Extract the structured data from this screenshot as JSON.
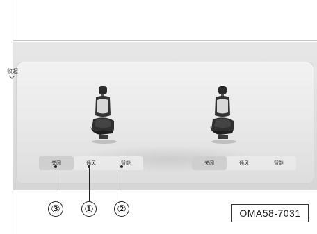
{
  "panel": {
    "collapse_label": "收起"
  },
  "left_seat": {
    "buttons": [
      "关闭",
      "通风",
      "智能"
    ],
    "selected": "关闭"
  },
  "right_seat": {
    "buttons": [
      "关闭",
      "通风",
      "智能"
    ],
    "selected": "关闭"
  },
  "callouts": [
    "③",
    "①",
    "②"
  ],
  "figure_code": "OMA58-7031",
  "colors": {
    "panel_bg": "#e7e7e7",
    "button_active_bg": "#cfcfcf",
    "seat_dark": "#2b2b2b"
  }
}
